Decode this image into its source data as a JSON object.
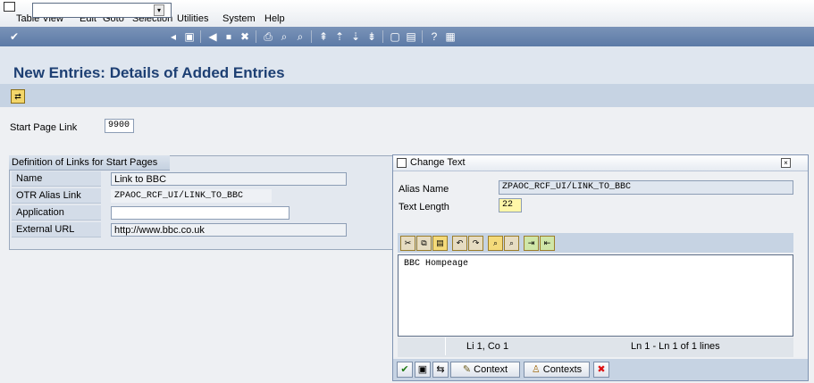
{
  "menu": [
    "Table View",
    "Edit",
    "Goto",
    "Selection",
    "Utilities",
    "System",
    "Help"
  ],
  "page_title": "New Entries: Details of Added Entries",
  "start_page": {
    "label": "Start Page Link",
    "value": "9900"
  },
  "group": {
    "title": "Definition of Links for Start Pages",
    "rows": [
      {
        "label": "Name",
        "value": "Link to BBC"
      },
      {
        "label": "OTR Alias Link",
        "value": "ZPAOC_RCF_UI/LINK_TO_BBC"
      },
      {
        "label": "Application",
        "value": ""
      },
      {
        "label": "External URL",
        "value": "http://www.bbc.co.uk"
      }
    ]
  },
  "dialog": {
    "title": "Change Text",
    "alias_label": "Alias Name",
    "alias_value": "ZPAOC_RCF_UI/LINK_TO_BBC",
    "length_label": "Text Length",
    "length_value": "22",
    "text": "BBC Hompeage",
    "status_pos": "Li 1, Co 1",
    "status_lines": "Ln 1 - Ln 1 of 1 lines",
    "btn_context": "Context",
    "btn_contexts": "Contexts"
  },
  "colors": {
    "title": "#1d3f73",
    "toolbar": "#5c7aa6",
    "highlight_field": "#fff7a8"
  }
}
